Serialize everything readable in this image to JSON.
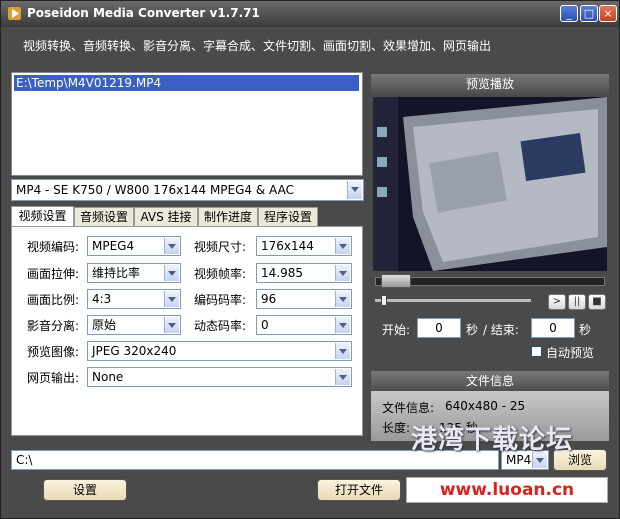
{
  "window": {
    "title": "Poseidon Media Converter v1.7.71",
    "minimize": "_",
    "maximize": "□",
    "close": "×"
  },
  "menu": {
    "text": "视频转换、音频转换、影音分离、字幕合成、文件切割、画面切割、效果增加、网页输出"
  },
  "file_list": {
    "items": [
      "E:\\Temp\\M4V01219.MP4"
    ]
  },
  "profile": {
    "value": "MP4 - SE K750 / W800 176x144 MPEG4 & AAC"
  },
  "tabs": [
    "视频设置",
    "音频设置",
    "AVS 挂接",
    "制作进度",
    "程序设置"
  ],
  "video_settings": {
    "video_codec": {
      "label": "视频编码:",
      "value": "MPEG4"
    },
    "video_size": {
      "label": "视频尺寸:",
      "value": "176x144"
    },
    "stretch": {
      "label": "画面拉伸:",
      "value": "维持比率"
    },
    "frame_rate": {
      "label": "视频帧率:",
      "value": "14.985"
    },
    "aspect": {
      "label": "画面比例:",
      "value": "4:3"
    },
    "bitrate": {
      "label": "编码码率:",
      "value": "96"
    },
    "av_split": {
      "label": "影音分离:",
      "value": "原始"
    },
    "dyn_bitrate": {
      "label": "动态码率:",
      "value": "0"
    },
    "preview_image": {
      "label": "预览图像:",
      "value": "JPEG 320x240"
    },
    "web_output": {
      "label": "网页输出:",
      "value": "None"
    }
  },
  "preview": {
    "header": "预览播放",
    "seek_fraction": 0.03
  },
  "playback": {
    "play": ">",
    "pause": "||",
    "stop": "■",
    "start_label": "开始:",
    "start_value": "0",
    "sec": "秒",
    "end_label": "/ 结束:",
    "end_value": "0",
    "sec2": "秒",
    "auto_preview": "自动预览"
  },
  "file_info": {
    "header": "文件信息",
    "video_label": "文件信息:",
    "video_value": "640x480 - 25",
    "length_label": "长度:",
    "length_value": "125 秒"
  },
  "output": {
    "path": "C:\\",
    "format": "MP4",
    "browse": "浏览"
  },
  "buttons": {
    "settings": "设置",
    "open_file": "打开文件"
  },
  "watermark": {
    "text": "港湾下载论坛",
    "url": "www.luoan.cn"
  }
}
